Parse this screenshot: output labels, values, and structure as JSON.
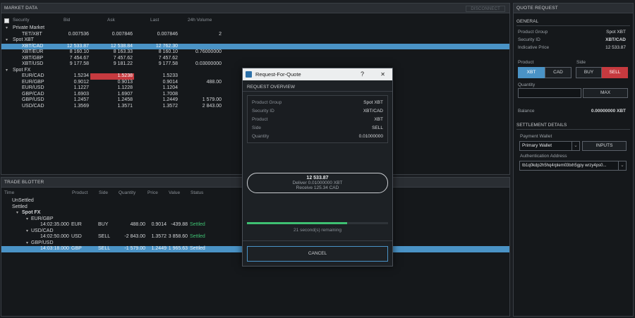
{
  "market": {
    "title": "MARKET DATA",
    "disconnect": "DISCONNECT",
    "columns": {
      "security": "Security",
      "bid": "Bid",
      "ask": "Ask",
      "last": "Last",
      "vol": "24h Volume"
    },
    "groups": [
      {
        "name": "Private Market",
        "rows": [
          {
            "sec": "TET/XBT",
            "bid": "0.007536",
            "ask": "0.007846",
            "last": "0.007846",
            "vol": "2"
          }
        ]
      },
      {
        "name": "Spot XBT",
        "rows": [
          {
            "sec": "XBT/CAD",
            "bid": "12 533.87",
            "ask": "12 538.84",
            "last": "12 762.30",
            "vol": ""
          },
          {
            "sec": "XBT/EUR",
            "bid": "8 160.10",
            "ask": "8 163.33",
            "last": "8 160.10",
            "vol": "0.76000000"
          },
          {
            "sec": "XBT/GBP",
            "bid": "7 454.67",
            "ask": "7 457.62",
            "last": "7 457.62",
            "vol": ""
          },
          {
            "sec": "XBT/USD",
            "bid": "9 177.58",
            "ask": "9 181.22",
            "last": "9 177.58",
            "vol": "0.03000000"
          }
        ]
      },
      {
        "name": "Spot FX",
        "rows": [
          {
            "sec": "EUR/CAD",
            "bid": "1.5234",
            "ask": "1.5238",
            "last": "1.5233",
            "vol": ""
          },
          {
            "sec": "EUR/GBP",
            "bid": "0.9012",
            "ask": "0.9013",
            "last": "0.9014",
            "vol": "488.00"
          },
          {
            "sec": "EUR/USD",
            "bid": "1.1227",
            "ask": "1.1228",
            "last": "1.1204",
            "vol": ""
          },
          {
            "sec": "GBP/CAD",
            "bid": "1.6903",
            "ask": "1.6907",
            "last": "1.7008",
            "vol": ""
          },
          {
            "sec": "GBP/USD",
            "bid": "1.2457",
            "ask": "1.2458",
            "last": "1.2449",
            "vol": "1 579.00"
          },
          {
            "sec": "USD/CAD",
            "bid": "1.3569",
            "ask": "1.3571",
            "last": "1.3572",
            "vol": "2 843.00"
          }
        ]
      }
    ]
  },
  "blotter": {
    "title": "TRADE BLOTTER",
    "columns": {
      "time": "Time",
      "product": "Product",
      "side": "Side",
      "qty": "Quantity",
      "price": "Price",
      "value": "Value",
      "status": "Status"
    },
    "unsettled": "UnSettled",
    "settled": "Settled",
    "spotfx": "Spot FX",
    "trades": [
      {
        "pair": "EUR/GBP",
        "time": "14:02:35.000",
        "product": "EUR",
        "side": "BUY",
        "qty": "488.00",
        "price": "0.9014",
        "value": "-439.88",
        "status": "Settled"
      },
      {
        "pair": "USD/CAD",
        "time": "14:02:50.000",
        "product": "USD",
        "side": "SELL",
        "qty": "-2 843.00",
        "price": "1.3572",
        "value": "3 858.60",
        "status": "Settled"
      },
      {
        "pair": "GBP/USD",
        "time": "14:03:18.000",
        "product": "GBP",
        "side": "SELL",
        "qty": "-1 579.00",
        "price": "1.2449",
        "value": "1 965.63",
        "status": "Settled"
      }
    ]
  },
  "quote": {
    "title": "QUOTE REQUEST",
    "general": "GENERAL",
    "product_group_label": "Product Group",
    "product_group": "Spot XBT",
    "security_id_label": "Security ID",
    "security_id": "XBT/CAD",
    "indicative_label": "Indicative Price",
    "indicative": "12 533.87",
    "product_label": "Product",
    "side_label": "Side",
    "product_a": "XBT",
    "product_b": "CAD",
    "buy": "BUY",
    "sell": "SELL",
    "quantity_label": "Quantity",
    "quantity_value": "",
    "max": "MAX",
    "balance_label": "Balance",
    "balance": "0.00000000 XBT",
    "settlement": "SETTLEMENT DETAILS",
    "wallet_label": "Payment Wallet",
    "wallet": "Primary Wallet",
    "inputs": "INPUTS",
    "auth_label": "Authentication Address",
    "auth": "tb1q0kdp2h5hq4rplem03txh5gpy wrzy4ps0..."
  },
  "dialog": {
    "title": "Request-For-Quote",
    "help": "?",
    "close": "✕",
    "overview": "REQUEST OVERVIEW",
    "items": [
      {
        "k": "Product Group",
        "v": "Spot XBT"
      },
      {
        "k": "Security ID",
        "v": "XBT/CAD"
      },
      {
        "k": "Product",
        "v": "XBT"
      },
      {
        "k": "Side",
        "v": "SELL"
      },
      {
        "k": "Quantity",
        "v": "0.01000000"
      }
    ],
    "price": "12 533.87",
    "deliver": "Deliver 0.01000000 XBT",
    "receive": "Receive 125.34 CAD",
    "progress": 0.71,
    "remaining": "21 second(s) remaining",
    "cancel": "CANCEL"
  },
  "colors": {
    "accent": "#4a93c6",
    "sell": "#c63a3f",
    "settled": "#3ec072"
  }
}
